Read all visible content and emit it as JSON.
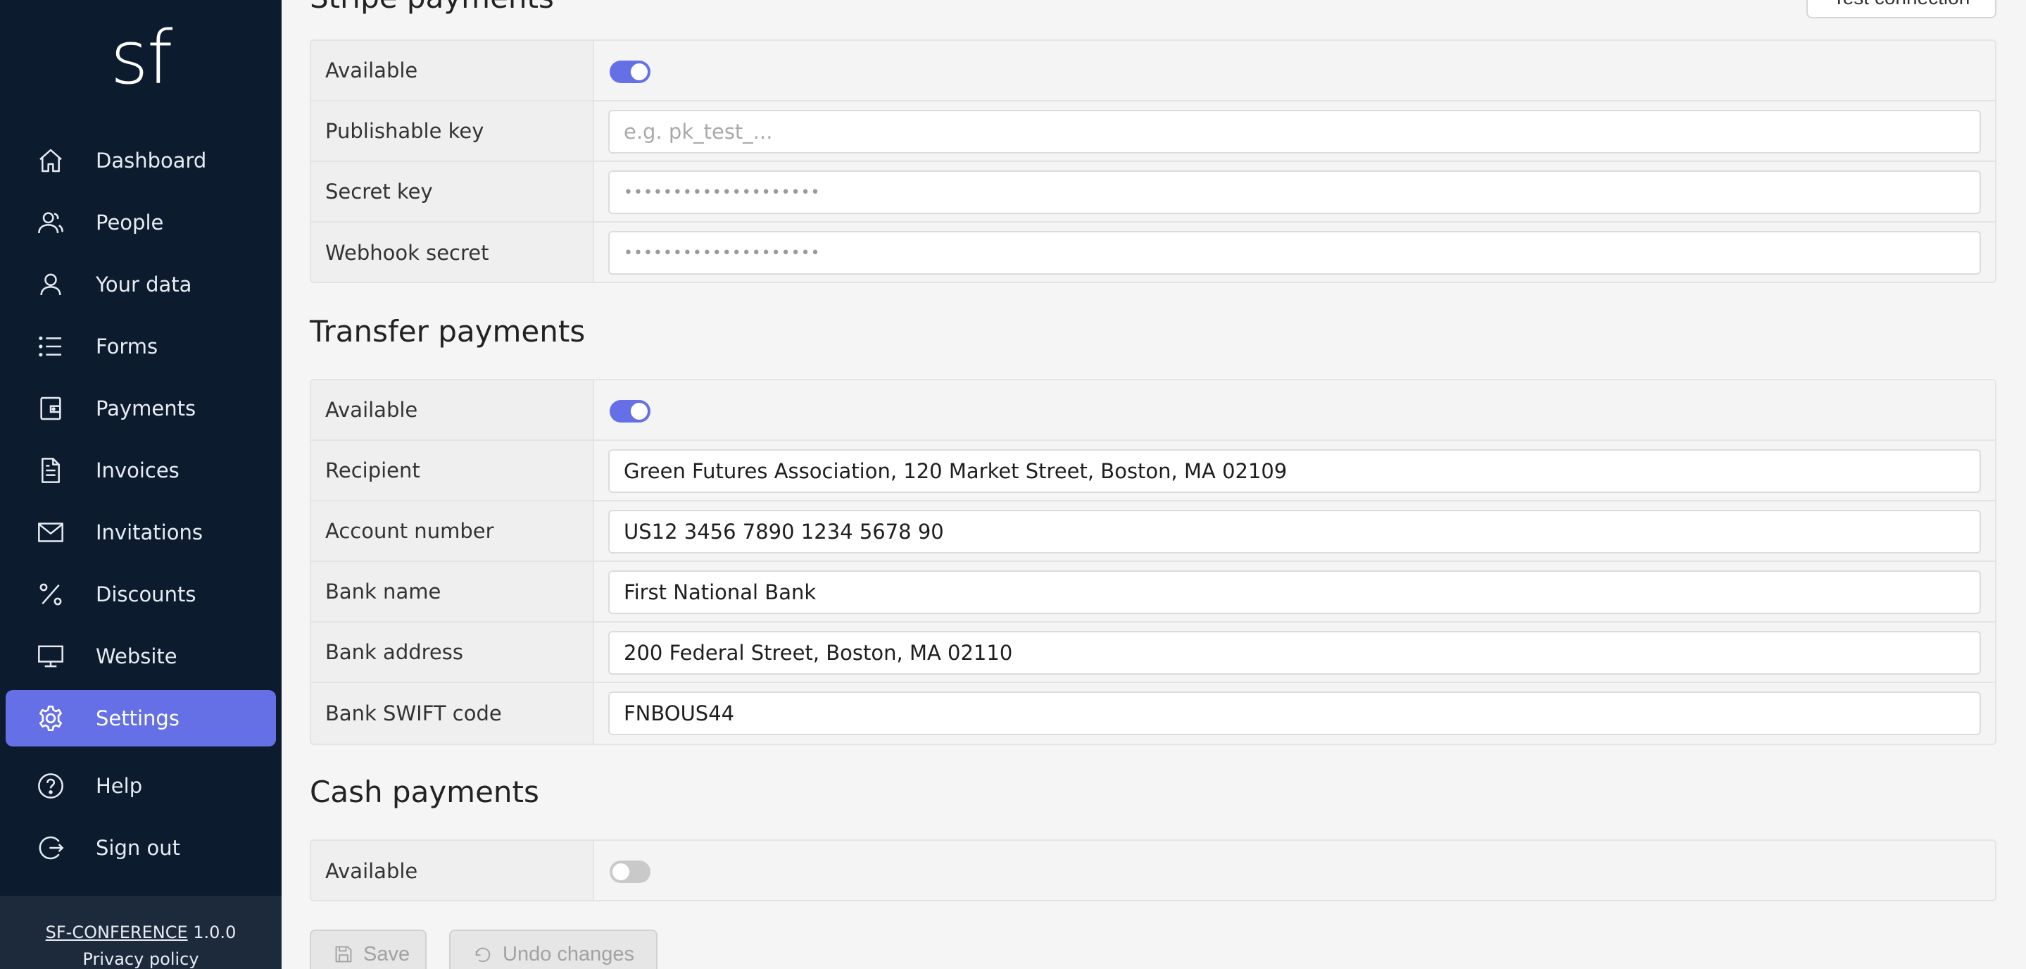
{
  "app": {
    "logo_text": "sf",
    "brand_link": "SF-CONFERENCE",
    "version": "1.0.0",
    "privacy_link": "Privacy policy"
  },
  "colors": {
    "sidebar_bg": "#0c1b2e",
    "accent": "#6570e6",
    "page_bg": "#f5f5f5"
  },
  "sidebar": {
    "items": [
      {
        "label": "Dashboard",
        "icon": "home-icon"
      },
      {
        "label": "People",
        "icon": "people-icon"
      },
      {
        "label": "Your data",
        "icon": "user-icon"
      },
      {
        "label": "Forms",
        "icon": "list-icon"
      },
      {
        "label": "Payments",
        "icon": "wallet-icon"
      },
      {
        "label": "Invoices",
        "icon": "document-icon"
      },
      {
        "label": "Invitations",
        "icon": "envelope-icon"
      },
      {
        "label": "Discounts",
        "icon": "percent-icon"
      },
      {
        "label": "Website",
        "icon": "monitor-icon"
      },
      {
        "label": "Settings",
        "icon": "gear-icon",
        "active": true
      },
      {
        "label": "Help",
        "icon": "help-icon"
      },
      {
        "label": "Sign out",
        "icon": "sign-out-icon"
      }
    ]
  },
  "stripe": {
    "title": "Stripe payments",
    "test_button": "Test connection",
    "available_label": "Available",
    "available": true,
    "publishable_label": "Publishable key",
    "publishable_placeholder": "e.g. pk_test_...",
    "secret_label": "Secret key",
    "secret_value": "••••••••••••••••••••",
    "webhook_label": "Webhook secret",
    "webhook_value": "••••••••••••••••••••"
  },
  "transfer": {
    "title": "Transfer payments",
    "available_label": "Available",
    "available": true,
    "recipient_label": "Recipient",
    "recipient_value": "Green Futures Association, 120 Market Street, Boston, MA 02109",
    "account_label": "Account number",
    "account_value": "US12 3456 7890 1234 5678 90",
    "bank_name_label": "Bank name",
    "bank_name_value": "First National Bank",
    "bank_address_label": "Bank address",
    "bank_address_value": "200 Federal Street, Boston, MA 02110",
    "swift_label": "Bank SWIFT code",
    "swift_value": "FNBOUS44"
  },
  "cash": {
    "title": "Cash payments",
    "available_label": "Available",
    "available": false
  },
  "actions": {
    "save_label": "Save",
    "undo_label": "Undo changes"
  }
}
